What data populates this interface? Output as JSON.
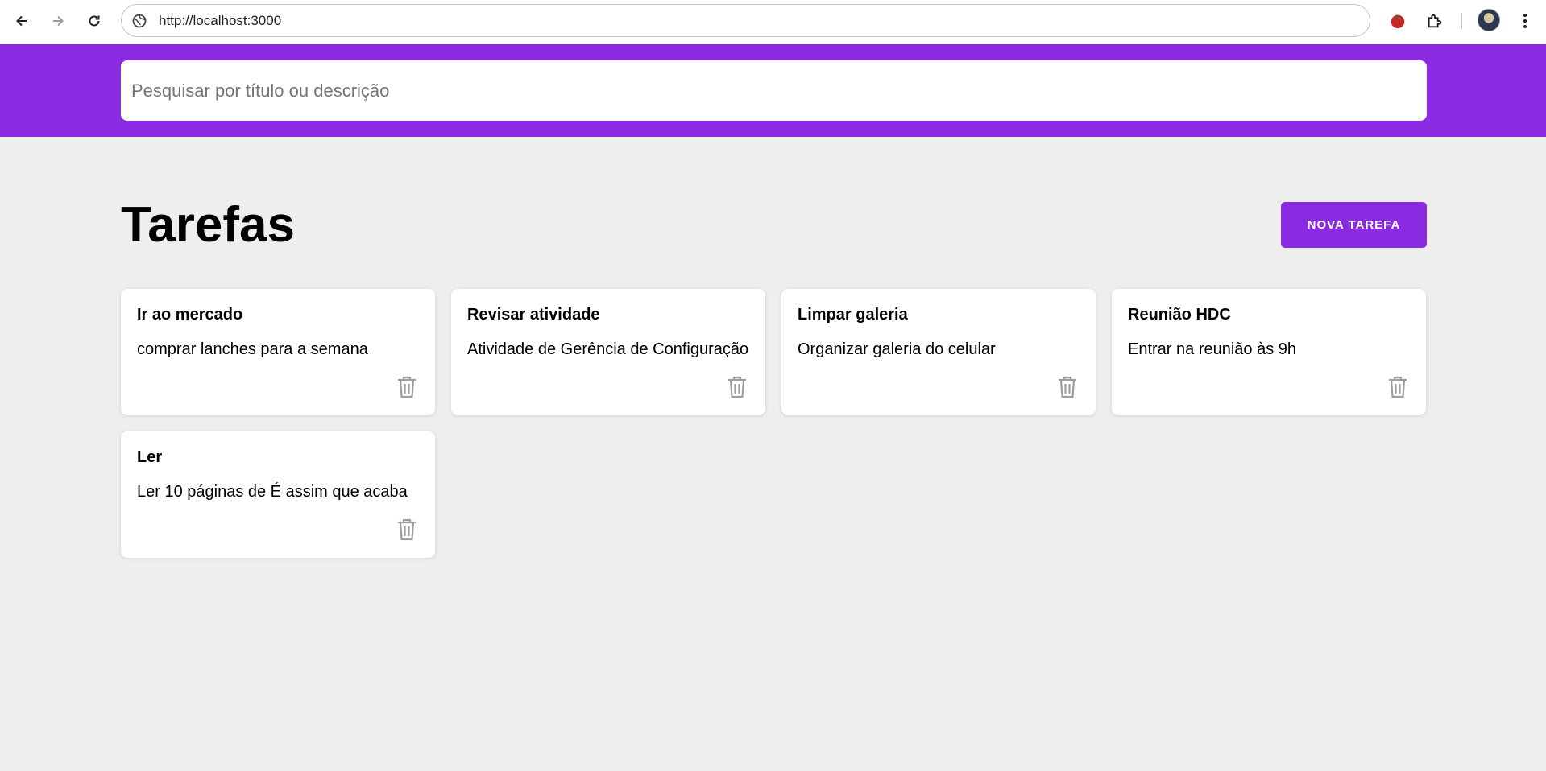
{
  "browser": {
    "url": "http://localhost:3000",
    "icons": [
      "back-arrow-icon",
      "forward-arrow-icon",
      "reload-icon",
      "site-info-icon",
      "tomato-extension-icon",
      "puzzle-extension-icon",
      "avatar",
      "kebab-menu-icon"
    ]
  },
  "colors": {
    "brand": "#8a2be2",
    "background": "#eeeeee",
    "card": "#ffffff",
    "trash_icon": "#9e9e9e"
  },
  "search": {
    "placeholder": "Pesquisar por título ou descrição",
    "value": ""
  },
  "main": {
    "title": "Tarefas",
    "new_task_label": "NOVA TAREFA"
  },
  "tasks": [
    {
      "title": "Ir ao mercado",
      "description": "comprar lanches para a semana"
    },
    {
      "title": "Revisar atividade",
      "description": "Atividade de Gerência de Configuração"
    },
    {
      "title": "Limpar galeria",
      "description": "Organizar galeria do celular"
    },
    {
      "title": "Reunião HDC",
      "description": "Entrar na reunião às 9h"
    },
    {
      "title": "Ler",
      "description": "Ler 10 páginas de É assim que acaba"
    }
  ]
}
